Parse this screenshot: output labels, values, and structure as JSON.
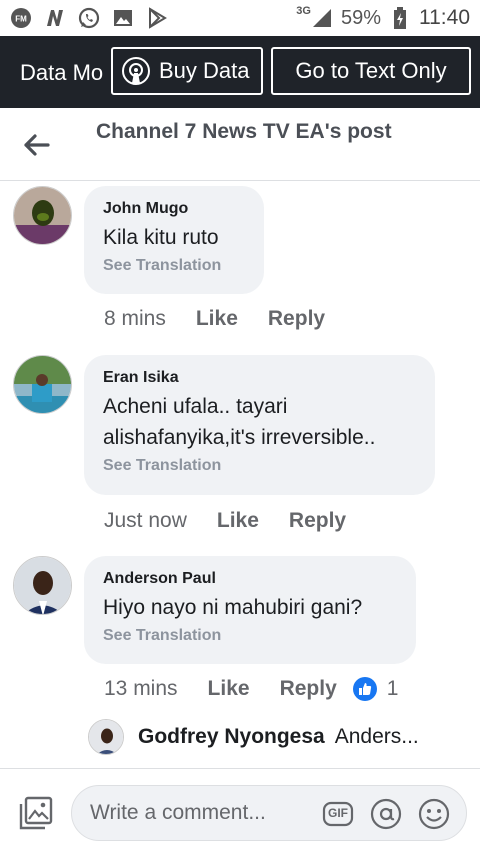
{
  "statusbar": {
    "network": "3G",
    "battery": "59%",
    "time": "11:40",
    "left_icons": [
      "fm-radio-icon",
      "n-app-icon",
      "whatsapp-icon",
      "gallery-icon",
      "play-store-icon"
    ]
  },
  "databar": {
    "label": "Data Mo",
    "buy_data": "Buy Data",
    "text_only": "Go to Text Only"
  },
  "header": {
    "title": "Channel 7 News TV EA's post"
  },
  "comments": [
    {
      "author": "John Mugo",
      "text": "Kila kitu ruto",
      "see_translation": "See Translation",
      "time": "8 mins",
      "like": "Like",
      "reply": "Reply"
    },
    {
      "author": "Eran Isika",
      "text": "Acheni ufala.. tayari alishafanyika,it's irreversible..",
      "see_translation": "See Translation",
      "time": "Just now",
      "like": "Like",
      "reply": "Reply"
    },
    {
      "author": "Anderson Paul",
      "text": "Hiyo nayo ni mahubiri gani?",
      "see_translation": "See Translation",
      "time": "13 mins",
      "like": "Like",
      "reply": "Reply",
      "reaction_count": "1"
    }
  ],
  "reply_preview": {
    "name": "Godfrey Nyongesa",
    "snippet": "Anders..."
  },
  "composer": {
    "placeholder": "Write a comment...",
    "gif": "GIF"
  },
  "colors": {
    "accent": "#1877f2",
    "databar_bg": "#1f2329",
    "bubble_bg": "#f0f2f5"
  }
}
